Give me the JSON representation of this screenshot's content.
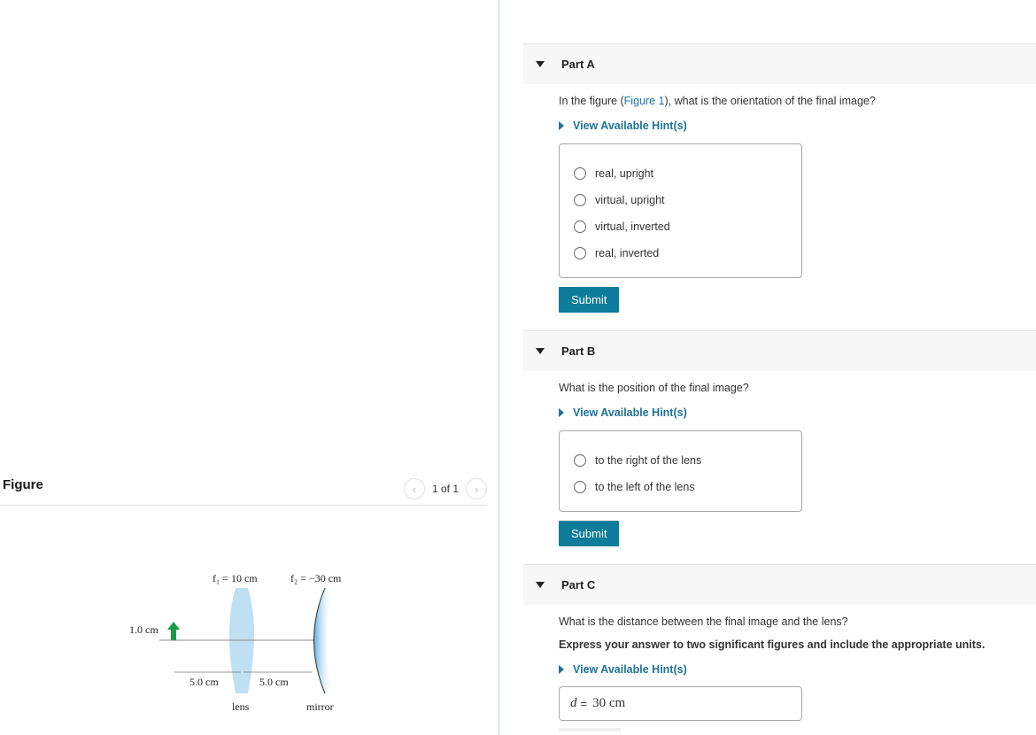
{
  "figure_panel": {
    "title": "Figure",
    "pager": {
      "prev_icon": "chevron-left-icon",
      "next_icon": "chevron-right-icon",
      "prev_glyph": "‹",
      "next_glyph": "›",
      "text": "1 of 1"
    },
    "diagram": {
      "f1_label": "f₁ = 10 cm",
      "f2_label": "f₂ = −30 cm",
      "object_height_label": "1.0 cm",
      "distance_left_label": "5.0 cm",
      "distance_right_label": "5.0 cm",
      "lens_label": "lens",
      "mirror_label": "mirror",
      "colors": {
        "arrow": "#1a9a4a",
        "lens": "#bfe0f2",
        "mirror": "#7ec0e6"
      }
    }
  },
  "parts": [
    {
      "title": "Part A",
      "question_prefix": "In the figure (",
      "question_link": "Figure 1",
      "question_suffix": "), what is the orientation of the final image?",
      "hint_label": "View Available Hint(s)",
      "options": [
        "real, upright",
        "virtual, upright",
        "virtual, inverted",
        "real, inverted"
      ],
      "submit_label": "Submit"
    },
    {
      "title": "Part B",
      "question": "What is the position of the final image?",
      "hint_label": "View Available Hint(s)",
      "options": [
        "to the right of the lens",
        "to the left of the lens"
      ],
      "submit_label": "Submit"
    },
    {
      "title": "Part C",
      "question": "What is the distance between the final image and the lens?",
      "instruction": "Express your answer to two significant figures and include the appropriate units.",
      "hint_label": "View Available Hint(s)",
      "answer": {
        "variable": "d",
        "equals": "=",
        "value": "30 cm"
      }
    }
  ],
  "colors": {
    "accent": "#0e7c9b",
    "link": "#1a73a8",
    "header_bg": "#f7f7f7"
  }
}
